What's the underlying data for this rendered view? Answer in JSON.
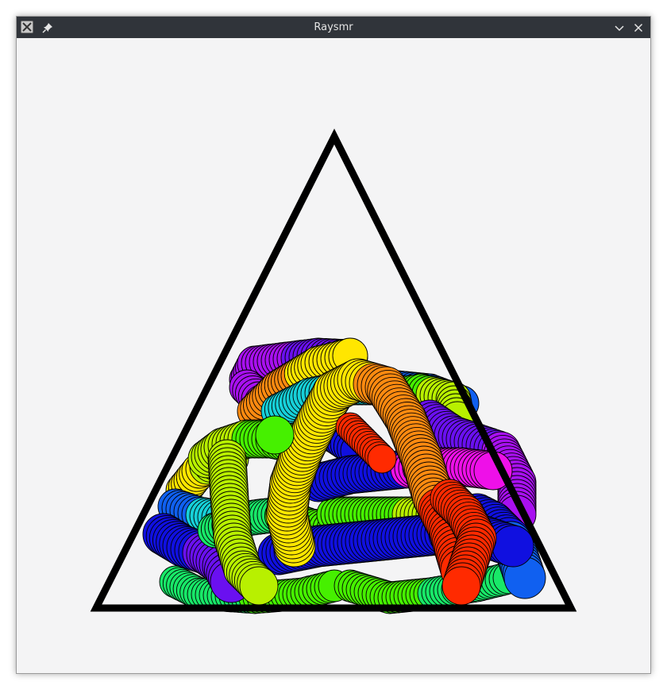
{
  "window": {
    "title": "Raysmr",
    "app_icon": "x11-app-icon",
    "pin_icon": "pin-icon",
    "minimize_icon": "chevron-down-icon",
    "close_icon": "close-icon"
  },
  "scene": {
    "background_color": "#f4f4f5",
    "frame_color": "#000000",
    "outline_color": "#000000",
    "palette": [
      "#ff2a00",
      "#ff8a10",
      "#ffe600",
      "#b8f000",
      "#46f000",
      "#18e868",
      "#16d0d8",
      "#1060f0",
      "#1010e0",
      "#6a10f0",
      "#a810f0",
      "#ee10e8"
    ]
  }
}
